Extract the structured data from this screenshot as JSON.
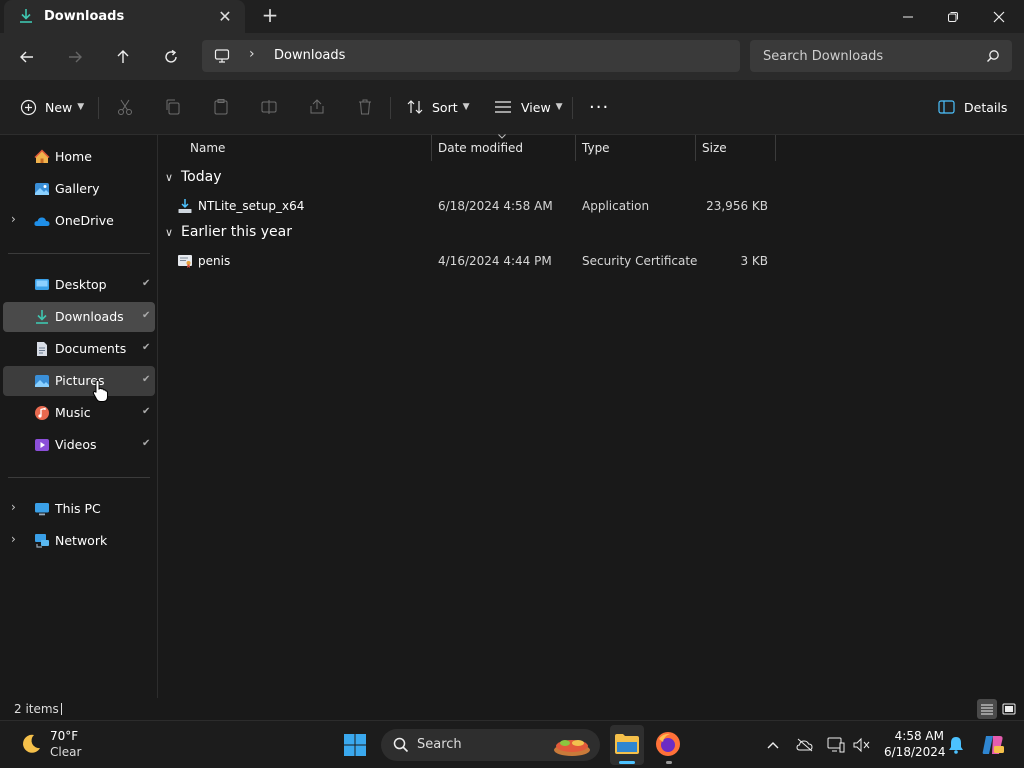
{
  "tab": {
    "title": "Downloads",
    "close_glyph": "✕",
    "new_glyph": "+"
  },
  "window_controls": {
    "minimize": "—",
    "restore": "❐",
    "close": "✕"
  },
  "address": {
    "chevron": "›",
    "crumb": "Downloads"
  },
  "search": {
    "placeholder": "Search Downloads"
  },
  "commands": {
    "new": "New",
    "sort": "Sort",
    "view": "View",
    "more": "···",
    "details": "Details"
  },
  "sidebar": {
    "home": "Home",
    "gallery": "Gallery",
    "onedrive": "OneDrive",
    "desktop": "Desktop",
    "downloads": "Downloads",
    "documents": "Documents",
    "pictures": "Pictures",
    "music": "Music",
    "videos": "Videos",
    "this_pc": "This PC",
    "network": "Network",
    "expand_glyph": "›",
    "pin_glyph": "📌"
  },
  "columns": {
    "name": "Name",
    "date": "Date modified",
    "type": "Type",
    "size": "Size"
  },
  "groups": [
    {
      "label": "Today",
      "chevron": "∨"
    },
    {
      "label": "Earlier this year",
      "chevron": "∨"
    }
  ],
  "files": [
    {
      "name": "NTLite_setup_x64",
      "date": "6/18/2024 4:58 AM",
      "type": "Application",
      "size": "23,956 KB",
      "icon": "installer-icon"
    },
    {
      "name": "penis",
      "date": "4/16/2024 4:44 PM",
      "type": "Security Certificate",
      "size": "3 KB",
      "icon": "certificate-icon"
    }
  ],
  "status": {
    "count": "2 items"
  },
  "taskbar": {
    "weather_temp": "70°F",
    "weather_cond": "Clear",
    "search_label": "Search",
    "time": "4:58 AM",
    "date": "6/18/2024"
  },
  "colors": {
    "accent": "#4cc2ff",
    "selected": "#4a4a4a",
    "background": "#191919"
  }
}
